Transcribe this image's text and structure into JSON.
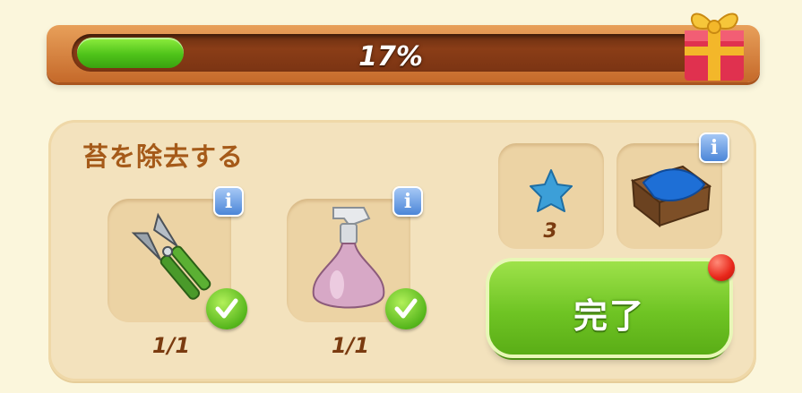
{
  "progress": {
    "percent_label": "17%",
    "fill_fraction": 0.17
  },
  "task": {
    "title": "苔を除去する"
  },
  "tools": [
    {
      "name": "pruning-shears",
      "count": "1/1"
    },
    {
      "name": "spray-bottle",
      "count": "1/1"
    }
  ],
  "rewards": [
    {
      "name": "blue-star-gem",
      "count": "3"
    },
    {
      "name": "blue-cloth-crate"
    }
  ],
  "info_icon_glyph": "i",
  "complete_button": {
    "label": "完了"
  },
  "colors": {
    "progress_fill": "#4fc31a",
    "title": "#a55a19",
    "button": "#6fc424",
    "notification": "#e8271a"
  }
}
